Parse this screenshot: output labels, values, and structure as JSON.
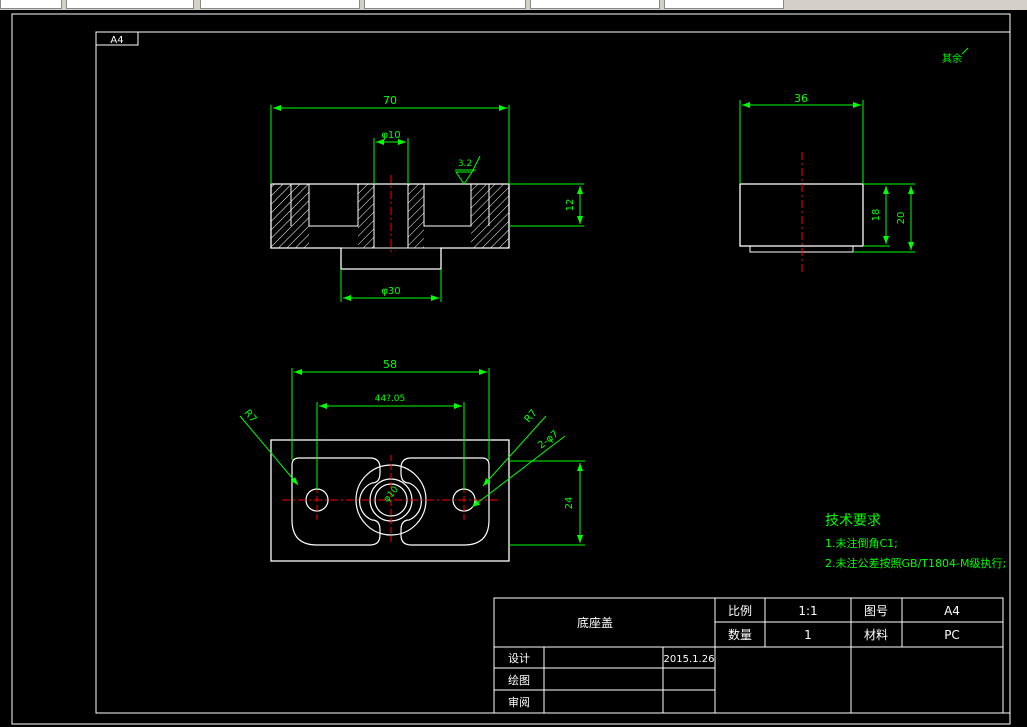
{
  "sheet": {
    "size_label": "A4",
    "corner_note": "其余"
  },
  "front_view": {
    "dim_width": "70",
    "dim_hole": "φ10",
    "dim_boss": "φ30",
    "dim_height": "12",
    "roughness": "3.2"
  },
  "side_view": {
    "dim_width": "36",
    "dim_h18": "18",
    "dim_h20": "20"
  },
  "top_view": {
    "dim_width": "58",
    "dim_pitch": "44?.05",
    "dim_r7_left": "R7",
    "dim_r7_right": "R7",
    "dim_holes": "2-φ7",
    "dim_height": "24",
    "dim_center": "φ10"
  },
  "tech_requirements": {
    "heading": "技术要求",
    "items": [
      "1.未注倒角C1;",
      "2.未注公差按照GB/T1804-M级执行;"
    ]
  },
  "title_block": {
    "part_name": "底座盖",
    "scale_label": "比例",
    "scale_value": "1:1",
    "drawing_no_label": "图号",
    "drawing_no_value": "A4",
    "qty_label": "数量",
    "qty_value": "1",
    "material_label": "材料",
    "material_value": "PC",
    "design_label": "设计",
    "design_date": "2015.1.26",
    "draw_label": "绘图",
    "review_label": "审阅"
  },
  "colors": {
    "outline": "#ffffff",
    "dimension": "#00ff00",
    "centerline": "#ff0000",
    "hatch": "#ffffff"
  }
}
